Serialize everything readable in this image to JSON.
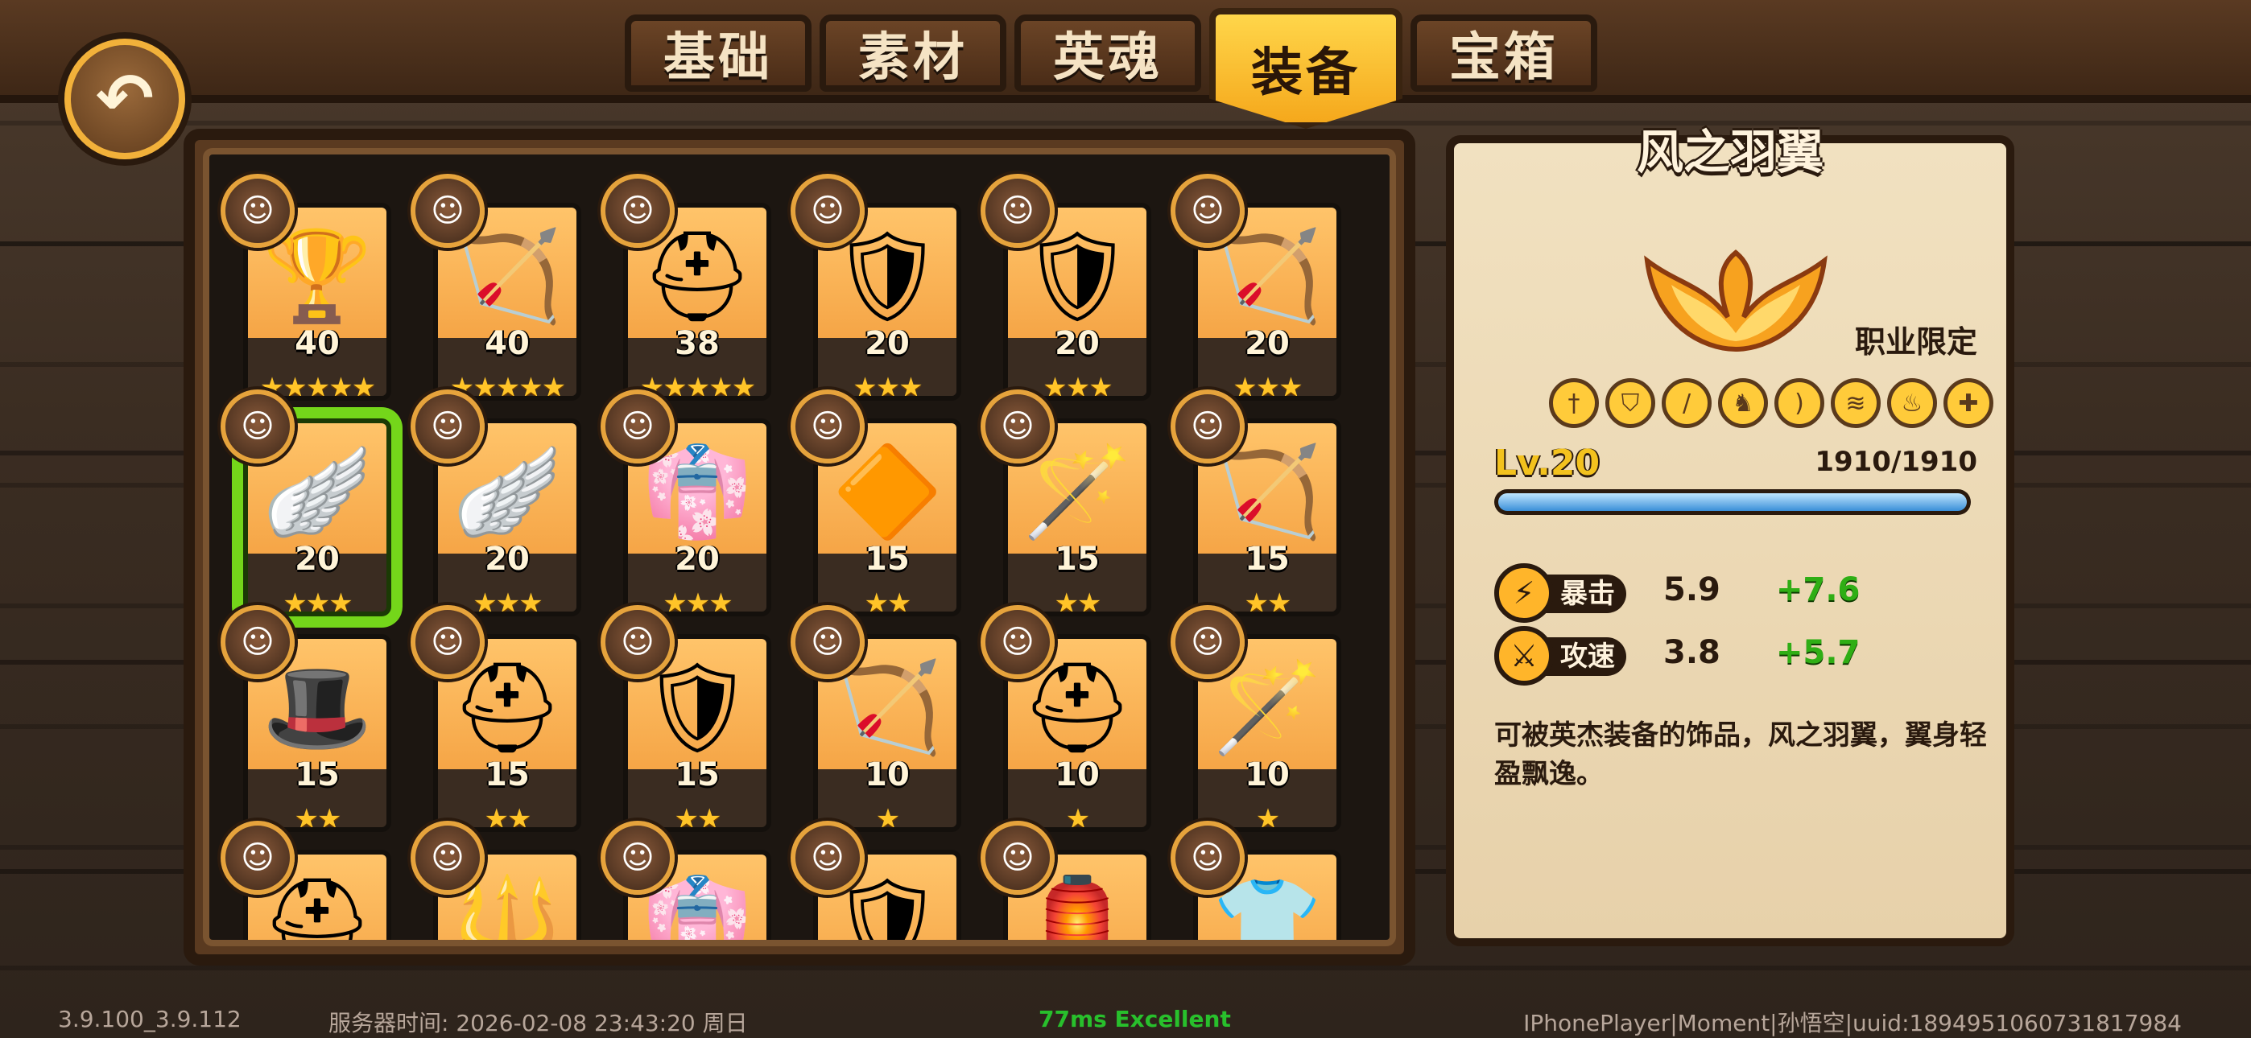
{
  "tabs": [
    {
      "label": "基础"
    },
    {
      "label": "素材"
    },
    {
      "label": "英魂"
    },
    {
      "label": "装备",
      "active": true
    },
    {
      "label": "宝箱"
    }
  ],
  "back_icon": "back-arrow",
  "items": [
    {
      "level": "40",
      "stars": 5,
      "icon": "golden-idol"
    },
    {
      "level": "40",
      "stars": 5,
      "icon": "bow"
    },
    {
      "level": "38",
      "stars": 5,
      "icon": "steel-helmet"
    },
    {
      "level": "20",
      "stars": 3,
      "icon": "dark-armor"
    },
    {
      "level": "20",
      "stars": 3,
      "icon": "steel-armor"
    },
    {
      "level": "20",
      "stars": 3,
      "icon": "wooden-bow"
    },
    {
      "level": "20",
      "stars": 3,
      "icon": "wings",
      "selected": true
    },
    {
      "level": "20",
      "stars": 3,
      "icon": "wings"
    },
    {
      "level": "20",
      "stars": 3,
      "icon": "red-robe"
    },
    {
      "level": "15",
      "stars": 2,
      "icon": "gem-amulet"
    },
    {
      "level": "15",
      "stars": 2,
      "icon": "staff"
    },
    {
      "level": "15",
      "stars": 2,
      "icon": "bow"
    },
    {
      "level": "15",
      "stars": 2,
      "icon": "wizard-hat"
    },
    {
      "level": "15",
      "stars": 2,
      "icon": "steel-helmet"
    },
    {
      "level": "15",
      "stars": 2,
      "icon": "iron-armor"
    },
    {
      "level": "10",
      "stars": 1,
      "icon": "bow"
    },
    {
      "level": "10",
      "stars": 1,
      "icon": "knight-helmet"
    },
    {
      "level": "10",
      "stars": 1,
      "icon": "staff"
    },
    {
      "level": "",
      "stars": 0,
      "icon": "iron-helmet"
    },
    {
      "level": "",
      "stars": 0,
      "icon": "spear"
    },
    {
      "level": "",
      "stars": 0,
      "icon": "purple-robe"
    },
    {
      "level": "",
      "stars": 0,
      "icon": "chain-armor"
    },
    {
      "level": "",
      "stars": 0,
      "icon": "golden-lantern"
    },
    {
      "level": "",
      "stars": 0,
      "icon": "golden-robe"
    }
  ],
  "detail": {
    "title": "风之羽翼",
    "restriction": "职业限定",
    "class_icons": [
      "sword-icon",
      "shield-icon",
      "dagger-icon",
      "horse-icon",
      "bow-icon",
      "wind-icon",
      "fire-icon",
      "cross-icon"
    ],
    "level": "Lv.20",
    "exp": "1910/1910",
    "exp_fraction": 1.0,
    "stats": [
      {
        "label": "暴击",
        "base": "5.9",
        "bonus": "+7.6",
        "icon": "lightning-icon"
      },
      {
        "label": "攻速",
        "base": "3.8",
        "bonus": "+5.7",
        "icon": "sword-speed-icon"
      }
    ],
    "description": "可被英杰装备的饰品，风之羽翼，翼身轻盈飘逸。"
  },
  "footer": {
    "version": "3.9.100_3.9.112",
    "server_time": "服务器时间:   2026-02-08  23:43:20  周日",
    "ping": "77ms Excellent",
    "user": "IPhonePlayer|Moment|孙悟空|uuid:1894951060731817984"
  },
  "colors": {
    "accent": "#ffc428",
    "selected": "#74d61a",
    "bonus": "#2fae15"
  }
}
